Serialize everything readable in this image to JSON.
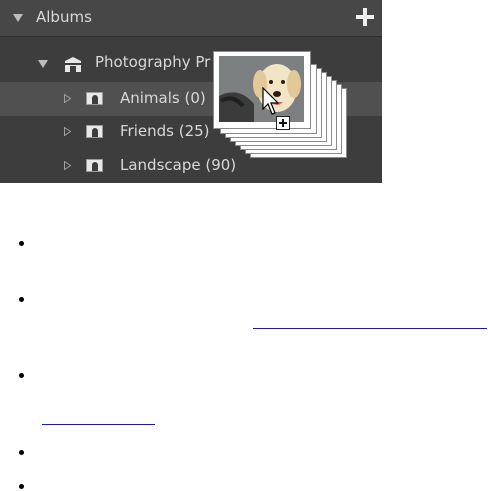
{
  "albums_panel": {
    "header_label": "Albums",
    "add_icon": "plus-icon",
    "collection": {
      "label": "Photography Pr",
      "icon": "collection-icon",
      "expanded": true
    },
    "albums": [
      {
        "label": "Animals (0)",
        "selected": true
      },
      {
        "label": "Friends (25)",
        "selected": false
      },
      {
        "label": "Landscape (90)",
        "selected": false
      }
    ],
    "drag_preview": {
      "icon": "dog-photo-thumbnail",
      "cursor_icon": "drag-copy-cursor-icon"
    }
  },
  "colors": {
    "panel_bg": "#3d3d3d",
    "header_bg": "#474747",
    "selected_row_bg": "#505050",
    "panel_text": "#d8d8d8",
    "link_underline": "#1a1aa6"
  },
  "bullet_list": {
    "item_count": 5
  }
}
